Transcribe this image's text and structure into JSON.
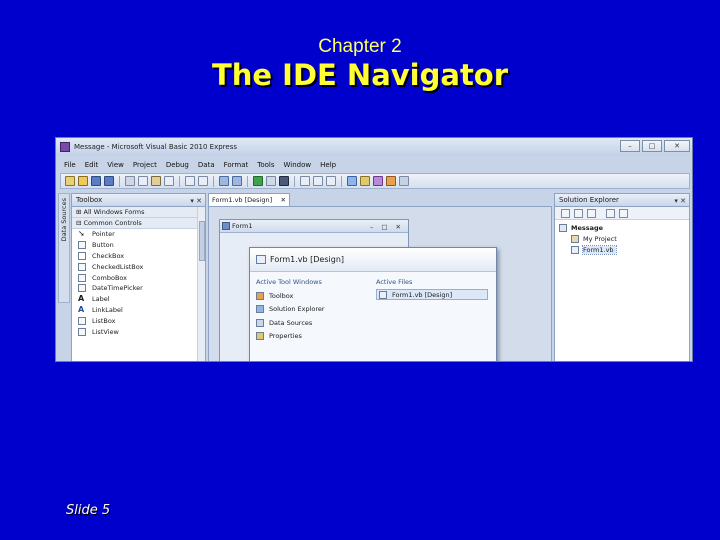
{
  "slide": {
    "subtitle": "Chapter 2",
    "title": "The IDE Navigator",
    "number": "Slide 5"
  },
  "window": {
    "title": "Message - Microsoft Visual Basic 2010 Express",
    "controls": {
      "minimize": "–",
      "maximize": "□",
      "close": "✕"
    }
  },
  "menu": [
    "File",
    "Edit",
    "View",
    "Project",
    "Debug",
    "Data",
    "Format",
    "Tools",
    "Window",
    "Help"
  ],
  "data_sources_tab": "Data Sources",
  "toolbox": {
    "title": "Toolbox",
    "pin": "▾ ✕",
    "groups": [
      "⊞ All Windows Forms",
      "⊟ Common Controls"
    ],
    "items": [
      "Pointer",
      "Button",
      "CheckBox",
      "CheckedListBox",
      "ComboBox",
      "DateTimePicker",
      "Label",
      "LinkLabel",
      "ListBox",
      "ListView"
    ]
  },
  "document": {
    "tab_label": "Form1.vb [Design]",
    "tab_close": "✕",
    "form_title": "Form1",
    "form_buttons": "– □ ✕"
  },
  "navigator": {
    "heading": "Form1.vb [Design]",
    "tool_windows_header": "Active Tool Windows",
    "tool_windows": [
      "Toolbox",
      "Solution Explorer",
      "Data Sources",
      "Properties"
    ],
    "active_files_header": "Active Files",
    "active_files": [
      "Form1.vb [Design]"
    ]
  },
  "solution_explorer": {
    "title": "Solution Explorer",
    "pin": "▾ ✕",
    "project": "Message",
    "children": [
      "My Project",
      "Form1.vb"
    ]
  }
}
